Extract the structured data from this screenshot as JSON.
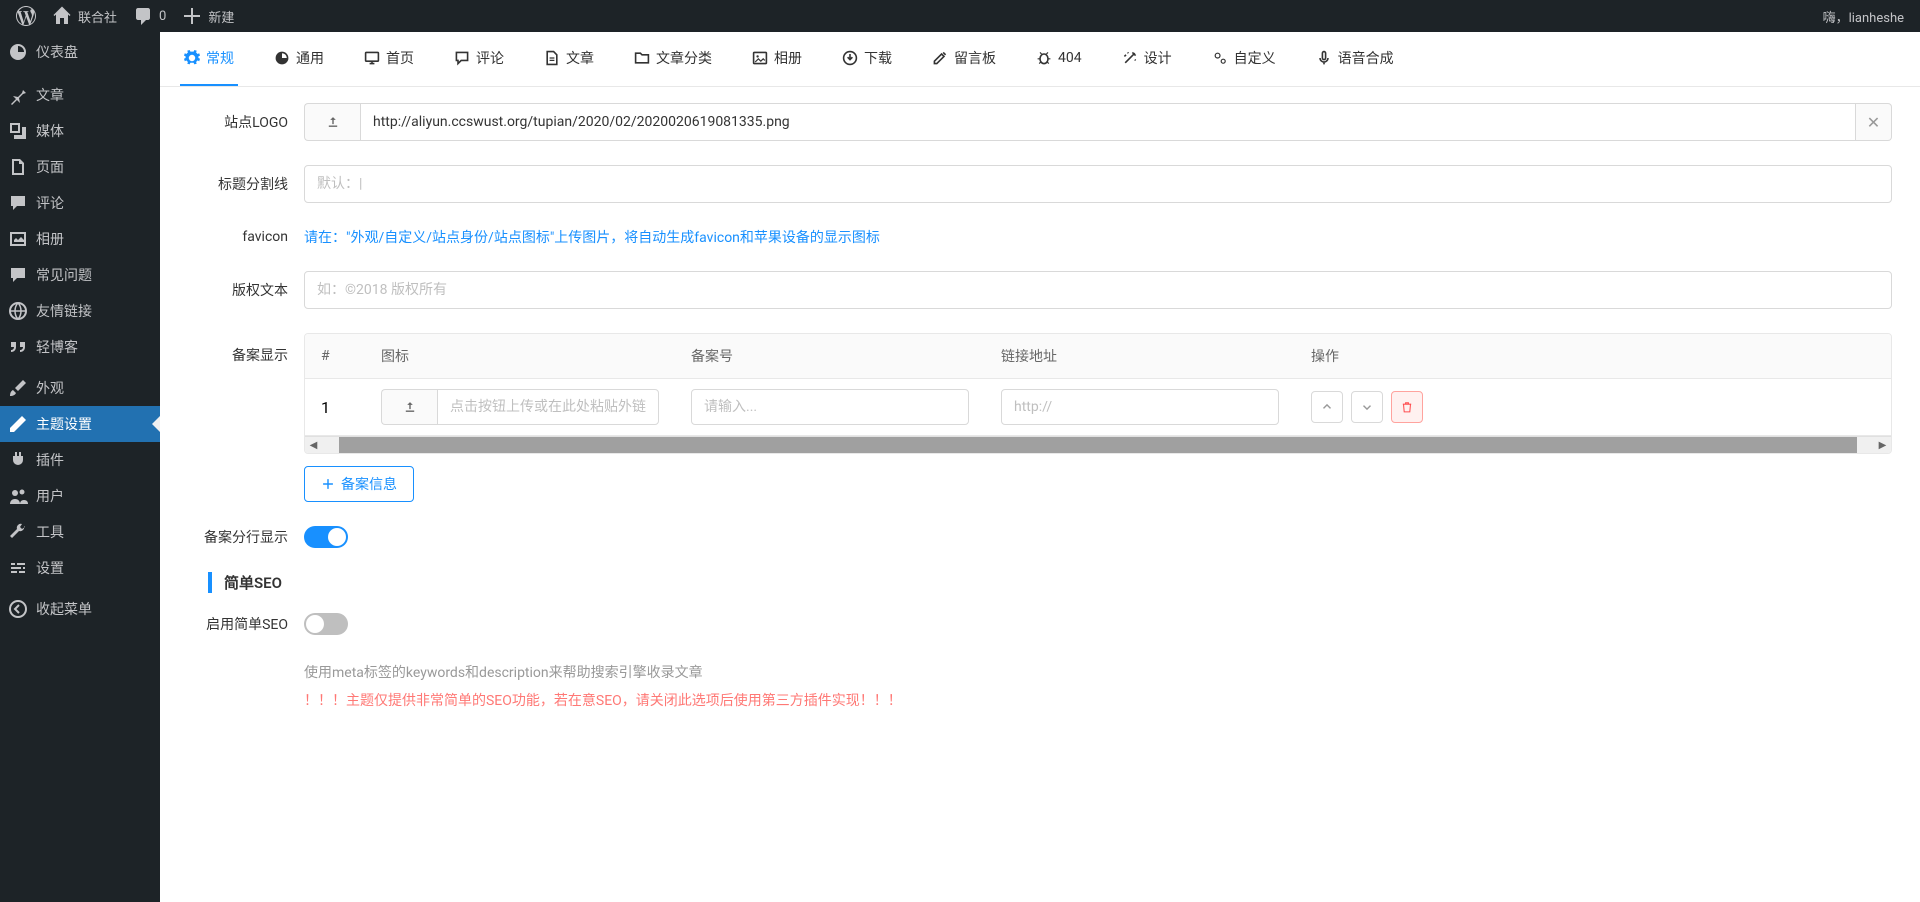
{
  "adminbar": {
    "site_name": "联合社",
    "comments": "0",
    "new": "新建",
    "greeting": "嗨，lianheshe"
  },
  "sidebar": {
    "dashboard": "仪表盘",
    "posts": "文章",
    "media": "媒体",
    "pages": "页面",
    "comments": "评论",
    "gallery": "相册",
    "faq": "常见问题",
    "links": "友情链接",
    "qingblog": "轻博客",
    "appearance": "外观",
    "theme_settings": "主题设置",
    "plugins": "插件",
    "users": "用户",
    "tools": "工具",
    "settings": "设置",
    "collapse": "收起菜单"
  },
  "tabs": {
    "general": "常规",
    "common": "通用",
    "home": "首页",
    "comments": "评论",
    "posts": "文章",
    "category": "文章分类",
    "gallery": "相册",
    "download": "下载",
    "guestbook": "留言板",
    "e404": "404",
    "design": "设计",
    "customize": "自定义",
    "speech": "语音合成"
  },
  "form": {
    "logo_label": "站点LOGO",
    "logo_value": "http://aliyun.ccswust.org/tupian/2020/02/2020020619081335.png",
    "title_sep_label": "标题分割线",
    "title_sep_placeholder": "默认：|",
    "favicon_label": "favicon",
    "favicon_hint": "请在：\"外观/自定义/站点身份/站点图标\"上传图片，将自动生成favicon和苹果设备的显示图标",
    "copyright_label": "版权文本",
    "copyright_placeholder": "如：©2018 版权所有",
    "filing_label": "备案显示",
    "filing_table": {
      "col_num": "#",
      "col_icon": "图标",
      "col_no": "备案号",
      "col_link": "链接地址",
      "col_op": "操作",
      "row1_num": "1",
      "icon_placeholder": "点击按钮上传或在此处粘贴外链地址",
      "no_placeholder": "请输入...",
      "link_placeholder": "http://"
    },
    "add_filing": "备案信息",
    "filing_multiline_label": "备案分行显示",
    "seo_heading": "简单SEO",
    "seo_enable_label": "启用简单SEO",
    "seo_desc1": "使用meta标签的keywords和description来帮助搜索引擎收录文章",
    "seo_desc2": "！！！主题仅提供非常简单的SEO功能，若在意SEO，请关闭此选项后使用第三方插件实现！！！"
  }
}
